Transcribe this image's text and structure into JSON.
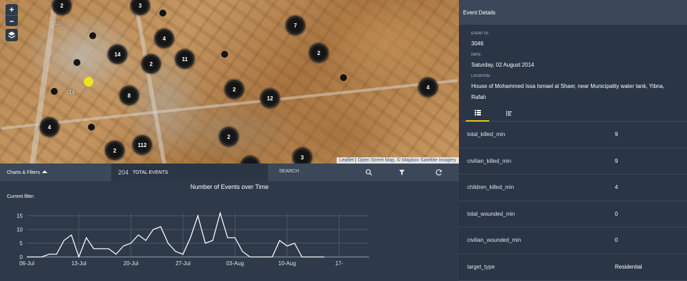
{
  "map": {
    "zoom_in": "+",
    "zoom_out": "−",
    "attribution": {
      "leaflet": "Leaflet",
      "sep": " | ",
      "osm": "Open Street Map",
      "mid": ", © ",
      "mapbox": "Mapbox Satellite Imagery"
    },
    "labels": [
      "10",
      "14"
    ],
    "clusters": [
      "2",
      "3",
      "4",
      "7",
      "14",
      "2",
      "11",
      "2",
      "8",
      "2",
      "12",
      "4",
      "4",
      "2",
      "2",
      "112",
      "2",
      "3"
    ]
  },
  "toolbar": {
    "charts_filters": "Charts & Filters",
    "total_count": "204",
    "total_label": "TOTAL EVENTS",
    "search_label": "SEARCH"
  },
  "chart": {
    "title": "Number of Events over Time",
    "current_filter": "Current filter:"
  },
  "chart_data": {
    "type": "line",
    "title": "Number of Events over Time",
    "xlabel": "",
    "ylabel": "",
    "x_ticks": [
      "06-Jul",
      "13-Jul",
      "20-Jul",
      "27-Jul",
      "03-Aug",
      "10-Aug",
      "17-"
    ],
    "y_ticks": [
      "0",
      "5",
      "10",
      "15"
    ],
    "ylim": [
      0,
      16
    ],
    "x": [
      "2014-07-06",
      "2014-07-07",
      "2014-07-08",
      "2014-07-09",
      "2014-07-10",
      "2014-07-11",
      "2014-07-12",
      "2014-07-13",
      "2014-07-14",
      "2014-07-15",
      "2014-07-16",
      "2014-07-17",
      "2014-07-18",
      "2014-07-19",
      "2014-07-20",
      "2014-07-21",
      "2014-07-22",
      "2014-07-23",
      "2014-07-24",
      "2014-07-25",
      "2014-07-26",
      "2014-07-27",
      "2014-07-28",
      "2014-07-29",
      "2014-07-30",
      "2014-07-31",
      "2014-08-01",
      "2014-08-02",
      "2014-08-03",
      "2014-08-04",
      "2014-08-05",
      "2014-08-06",
      "2014-08-07",
      "2014-08-08",
      "2014-08-09",
      "2014-08-10",
      "2014-08-11",
      "2014-08-12",
      "2014-08-13",
      "2014-08-14",
      "2014-08-15"
    ],
    "values": [
      0,
      0,
      0,
      1,
      1,
      6,
      8,
      0,
      7,
      3,
      3,
      3,
      1,
      4,
      5,
      8,
      6,
      10,
      11,
      5,
      2,
      1,
      7,
      15,
      5,
      6,
      16,
      7,
      7,
      2,
      0,
      0,
      0,
      0,
      6,
      4,
      5,
      0,
      0,
      0,
      0
    ],
    "grid": true
  },
  "details": {
    "header": "Event Details",
    "event_id_label": "EVENT ID:",
    "event_id": "3046",
    "date_label": "DATE:",
    "date": "Saturday, 02 August 2014",
    "location_label": "LOCATION:",
    "location": "House of Mohammed Issa Ismael al Shaer, near Municipality water tank, Yibna, Rafah",
    "rows": [
      {
        "key": "total_killed_min",
        "value": "9"
      },
      {
        "key": "civilian_killed_min",
        "value": "9"
      },
      {
        "key": "children_killed_min",
        "value": "4"
      },
      {
        "key": "total_wounded_min",
        "value": "0"
      },
      {
        "key": "civilian_wounded_min",
        "value": "0"
      },
      {
        "key": "target_type",
        "value": "Residential"
      }
    ]
  },
  "colors": {
    "accent": "#f0c419",
    "selected_event": "#f0e21a",
    "panel": "#2a3646",
    "header": "#3a4859"
  },
  "icons": [
    "zoom-in-icon",
    "zoom-out-icon",
    "layers-icon",
    "caret-up-icon",
    "search-icon",
    "filter-icon",
    "refresh-icon",
    "list-icon",
    "bar-chart-icon"
  ]
}
